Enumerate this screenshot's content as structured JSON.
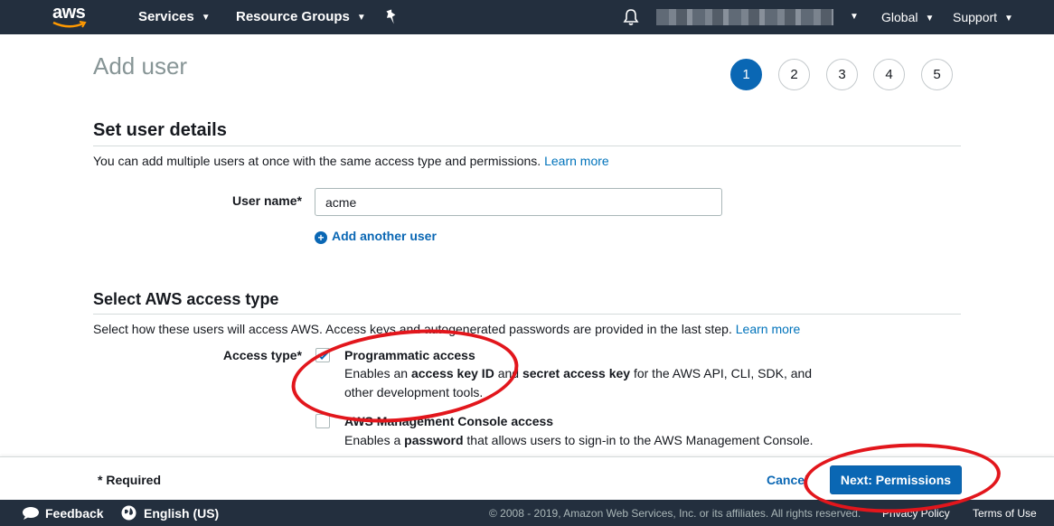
{
  "topnav": {
    "logo_text": "aws",
    "services": "Services",
    "resource_groups": "Resource Groups",
    "region": "Global",
    "support": "Support"
  },
  "page": {
    "title": "Add user",
    "steps": [
      "1",
      "2",
      "3",
      "4",
      "5"
    ],
    "active_step": "1"
  },
  "user_details": {
    "heading": "Set user details",
    "description": "You can add multiple users at once with the same access type and permissions.",
    "learn_more": "Learn more",
    "user_name_label": "User name*",
    "user_name_value": "acme",
    "add_another_user": "Add another user"
  },
  "access_type": {
    "heading": "Select AWS access type",
    "description": "Select how these users will access AWS. Access keys and autogenerated passwords are provided in the last step.",
    "learn_more": "Learn more",
    "label": "Access type*",
    "options": [
      {
        "title": "Programmatic access",
        "checked": true,
        "desc_parts": [
          "Enables an ",
          "access key ID",
          " and ",
          "secret access key",
          " for the AWS API, CLI, SDK, and other development tools."
        ]
      },
      {
        "title": "AWS Management Console access",
        "checked": false,
        "desc_parts": [
          "Enables a ",
          "password",
          " that allows users to sign-in to the AWS Management Console."
        ]
      }
    ]
  },
  "footer": {
    "required": "* Required",
    "cancel": "Cancel",
    "next": "Next: Permissions"
  },
  "bottombar": {
    "feedback": "Feedback",
    "language": "English (US)",
    "copyright": "© 2008 - 2019, Amazon Web Services, Inc. or its affiliates. All rights reserved.",
    "privacy": "Privacy Policy",
    "terms": "Terms of Use"
  },
  "colors": {
    "nav_bg": "#232f3e",
    "primary": "#0a67b4",
    "link": "#0073bb",
    "annotation": "#e2161c"
  }
}
